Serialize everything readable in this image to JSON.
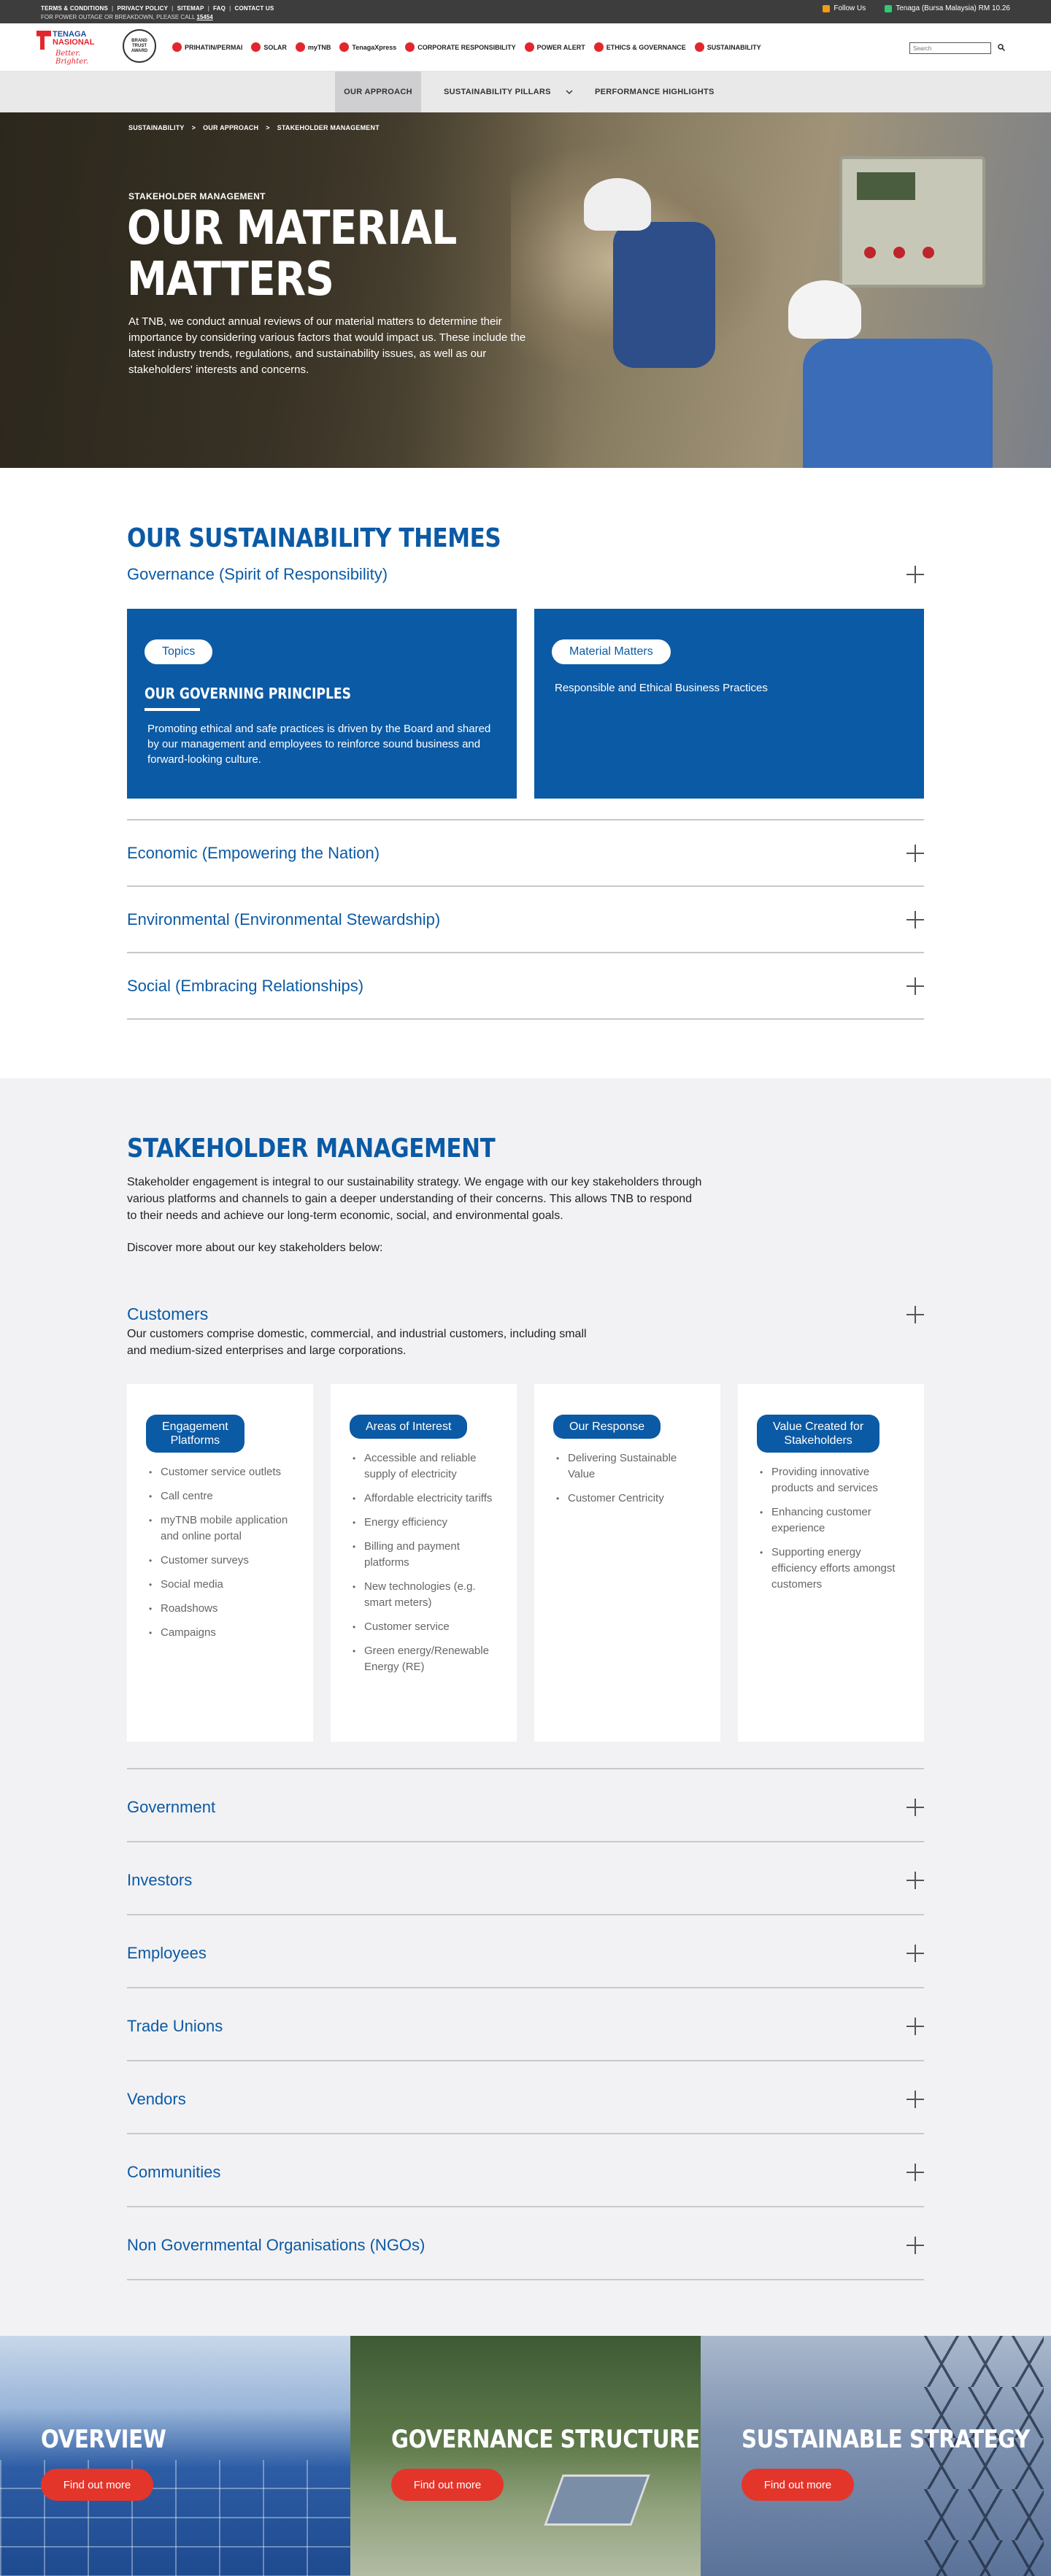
{
  "utility": {
    "links": [
      "TERMS & CONDITIONS",
      "PRIVACY POLICY",
      "SITEMAP",
      "FAQ",
      "CONTACT US"
    ],
    "outage_text": "FOR POWER OUTAGE OR BREAKDOWN, PLEASE CALL",
    "outage_number": "15454",
    "follow": "Follow Us",
    "stock": "Tenaga (Bursa Malaysia) RM 10.26"
  },
  "header": {
    "logo_line1": "TENAGA",
    "logo_line2": "NASIONAL",
    "logo_tagline": "Better. Brighter.",
    "badge_text": "BRAND TRUST AWARD",
    "nav": [
      "PRIHATIN/PERMAI",
      "SOLAR",
      "myTNB",
      "TenagaXpress",
      "CORPORATE RESPONSIBILITY",
      "POWER ALERT",
      "ETHICS & GOVERNANCE",
      "SUSTAINABILITY"
    ],
    "search_placeholder": "Search"
  },
  "subnav": {
    "tabs": [
      "OUR APPROACH",
      "SUSTAINABILITY PILLARS",
      "PERFORMANCE HIGHLIGHTS"
    ],
    "active": "OUR APPROACH"
  },
  "hero": {
    "breadcrumb": [
      "SUSTAINABILITY",
      "OUR APPROACH",
      "STAKEHOLDER MANAGEMENT"
    ],
    "breadcrumb_sep": ">",
    "kicker": "STAKEHOLDER MANAGEMENT",
    "title_line1": "OUR MATERIAL",
    "title_line2": "MATTERS",
    "lead": "At TNB, we conduct annual reviews of our material matters to determine their importance by considering various factors that would impact us. These include the latest industry trends, regulations, and sustainability issues, as well as our stakeholders' interests and concerns."
  },
  "themes": {
    "title": "OUR SUSTAINABILITY THEMES",
    "open_item": {
      "title": "Governance (Spirit of Responsibility)",
      "topics_label": "Topics",
      "topics_heading": "OUR GOVERNING PRINCIPLES",
      "topics_text": "Promoting ethical and safe practices is driven by the Board and shared by our management and employees to reinforce sound business and forward-looking culture.",
      "matters_label": "Material Matters",
      "matters_text": "Responsible and Ethical Business Practices"
    },
    "items": [
      "Economic (Empowering the Nation)",
      "Environmental (Environmental Stewardship)",
      "Social (Embracing Relationships)"
    ]
  },
  "stakeholders": {
    "title": "STAKEHOLDER MANAGEMENT",
    "intro": "Stakeholder engagement is integral to our sustainability strategy. We engage with our key stakeholders through various platforms and channels to gain a deeper understanding of their concerns. This allows TNB to respond to their needs and achieve our long-term economic, social, and environmental goals.",
    "discover": "Discover more about our key stakeholders below:",
    "customers": {
      "title": "Customers",
      "desc": "Our customers comprise domestic, commercial, and industrial customers, including small and medium-sized enterprises and large corporations.",
      "cards": [
        {
          "label_line1": "Engagement",
          "label_line2": "Platforms",
          "items": [
            "Customer service outlets",
            "Call centre",
            "myTNB mobile application and online portal",
            "Customer surveys",
            "Social media",
            "Roadshows",
            "Campaigns"
          ]
        },
        {
          "label_line1": "Areas of Interest",
          "label_line2": "",
          "items": [
            "Accessible and reliable supply of electricity",
            "Affordable electricity tariffs",
            "Energy efficiency",
            "Billing and payment platforms",
            "New technologies (e.g. smart meters)",
            "Customer service",
            "Green energy/Renewable Energy (RE)"
          ]
        },
        {
          "label_line1": "Our Response",
          "label_line2": "",
          "items": [
            "Delivering Sustainable Value",
            "Customer Centricity"
          ]
        },
        {
          "label_line1": "Value Created for",
          "label_line2": "Stakeholders",
          "items": [
            "Providing innovative products and services",
            "Enhancing customer experience",
            "Supporting energy efficiency efforts amongst customers"
          ]
        }
      ]
    },
    "items": [
      "Government",
      "Investors",
      "Employees",
      "Trade Unions",
      "Vendors",
      "Communities",
      "Non Governmental Organisations (NGOs)"
    ]
  },
  "tiles": [
    {
      "title": "OVERVIEW",
      "button": "Find out more"
    },
    {
      "title": "GOVERNANCE STRUCTURE",
      "button": "Find out more"
    },
    {
      "title": "SUSTAINABLE STRATEGY",
      "button": "Find out more"
    }
  ],
  "colors": {
    "brand_blue": "#0b5aa5",
    "brand_red": "#e3262d",
    "cta_red": "#e4352b"
  }
}
